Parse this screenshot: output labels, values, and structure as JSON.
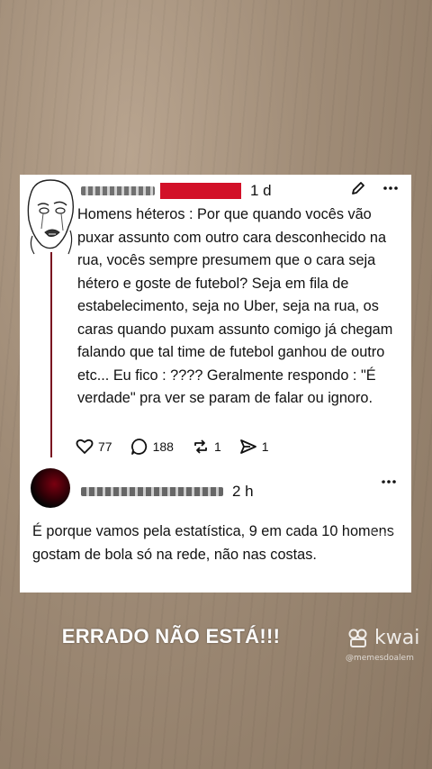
{
  "post": {
    "time": "1 d",
    "text": "Homens héteros : Por que quando vocês vão puxar assunto com outro cara desconhecido na rua, vocês sempre presumem que o cara seja hétero e goste de futebol? Seja em fila de estabelecimento, seja no Uber, seja na rua, os caras quando puxam assunto comigo já chegam falando que tal time de futebol ganhou de outro etc... Eu fico : ???? Geralmente respondo : \"É verdade\" pra ver se param de falar ou ignoro.",
    "likes": "77",
    "comments": "188",
    "reposts": "1",
    "shares": "1"
  },
  "reply": {
    "time": "2 h",
    "text": "É porque vamos pela estatística, 9 em cada 10 homens gostam de bola só na rede, não nas costas."
  },
  "overlay": {
    "caption": "ERRADO NÃO ESTÁ!!!",
    "brand": "kwai",
    "handle": "@memesdoalem"
  },
  "icons": {
    "edit": "pencil-icon",
    "more": "more-icon",
    "like": "heart-icon",
    "comment": "comment-icon",
    "repost": "repost-icon",
    "share": "send-icon"
  },
  "colors": {
    "redacted": "#d21028",
    "thread": "#7a1020"
  }
}
